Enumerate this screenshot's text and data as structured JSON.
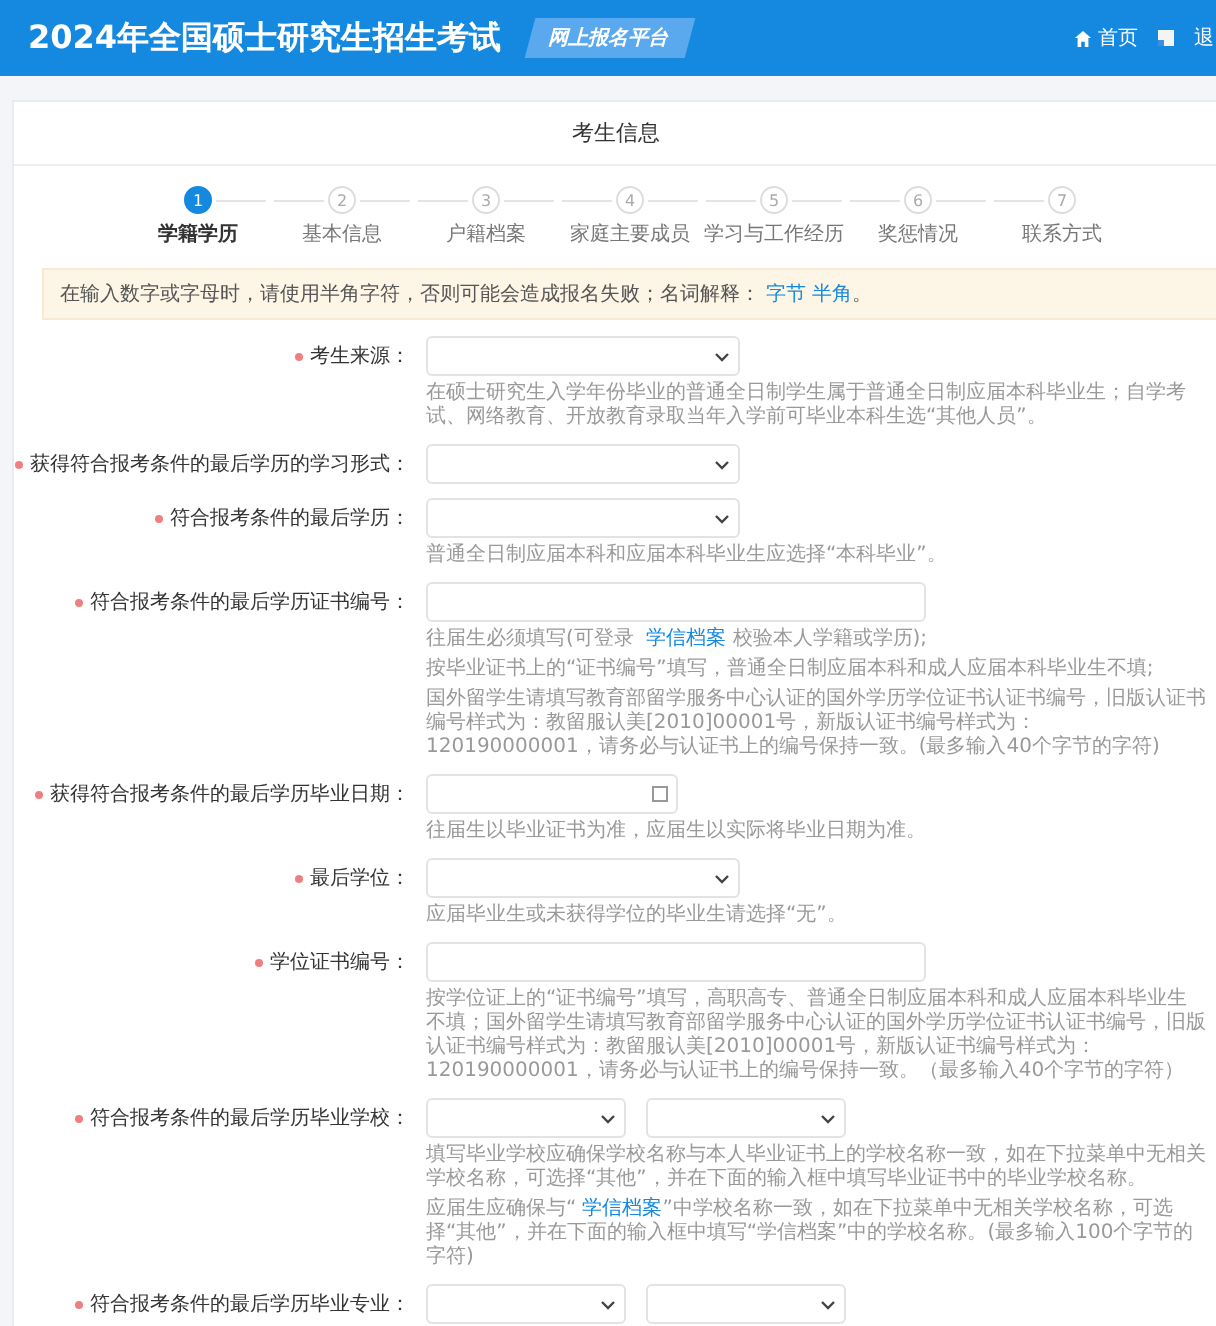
{
  "header": {
    "title": "2024年全国硕士研究生招生考试",
    "badge": "网上报名平台",
    "links": [
      {
        "kind": "home",
        "label": "首页"
      },
      {
        "kind": "exit",
        "label": "退"
      }
    ]
  },
  "card": {
    "title": "考生信息"
  },
  "steps": [
    {
      "number": "1",
      "label": "学籍学历",
      "selected": true
    },
    {
      "number": "2",
      "label": "基本信息",
      "selected": false
    },
    {
      "number": "3",
      "label": "户籍档案",
      "selected": false
    },
    {
      "number": "4",
      "label": "家庭主要成员",
      "selected": false
    },
    {
      "number": "5",
      "label": "学习与工作经历",
      "selected": false
    },
    {
      "number": "6",
      "label": "奖惩情况",
      "selected": false
    },
    {
      "number": "7",
      "label": "联系方式",
      "selected": false
    }
  ],
  "notice": [
    {
      "text": "在输入数字或字母时，请使用半角字符，否则可能会造成报名失败；名词解释："
    },
    {
      "link": "字节"
    },
    {
      "link": "半角"
    },
    {
      "text": "。"
    }
  ],
  "fields": [
    {
      "label": "考生来源：",
      "required": true,
      "kind": "select",
      "hints": [
        [
          {
            "text": "在硕士研究生入学年份毕业的普通全日制学生属于普通全日制应届本科毕业生；自学考试、网络教育、开放教育录取当年入学前可毕业本科生选“其他人员”。"
          }
        ]
      ]
    },
    {
      "label": "获得符合报考条件的最后学历的学习形式：",
      "required": true,
      "kind": "select"
    },
    {
      "label": "符合报考条件的最后学历：",
      "required": true,
      "kind": "select",
      "hints": [
        [
          {
            "text": "普通全日制应届本科和应届本科毕业生应选择“本科毕业”。"
          }
        ]
      ]
    },
    {
      "label": "符合报考条件的最后学历证书编号：",
      "required": true,
      "kind": "input",
      "hints": [
        [
          {
            "text": "往届生必须填写(可登录 "
          },
          {
            "link": "学信档案"
          },
          {
            "text": " 校验本人学籍或学历);"
          }
        ],
        [
          {
            "text": "按毕业证书上的“证书编号”填写，普通全日制应届本科和成人应届本科毕业生不填;"
          }
        ],
        [
          {
            "text": "国外留学生请填写教育部留学服务中心认证的国外学历学位证书认证书编号，旧版认证书编号样式为：教留服认美[2010]00001号，新版认证书编号样式为：120190000001，请务必与认证书上的编号保持一致。(最多输入40个字节的字符)"
          }
        ]
      ]
    },
    {
      "label": "获得符合报考条件的最后学历毕业日期：",
      "required": true,
      "kind": "date",
      "hints": [
        [
          {
            "text": "往届生以毕业证书为准，应届生以实际将毕业日期为准。"
          }
        ]
      ]
    },
    {
      "label": "最后学位：",
      "required": true,
      "kind": "select",
      "hints": [
        [
          {
            "text": "应届毕业生或未获得学位的毕业生请选择“无”。"
          }
        ]
      ]
    },
    {
      "label": "学位证书编号：",
      "required": true,
      "kind": "input",
      "hints": [
        [
          {
            "text": "按学位证上的“证书编号”填写，高职高专、普通全日制应届本科和成人应届本科毕业生不填；国外留学生请填写教育部留学服务中心认证的国外学历学位证书认证书编号，旧版认证书编号样式为：教留服认美[2010]00001号，新版认证书编号样式为：120190000001，请务必与认证书上的编号保持一致。（最多输入40个字节的字符）"
          }
        ]
      ]
    },
    {
      "label": "符合报考条件的最后学历毕业学校：",
      "required": true,
      "kind": "pair",
      "hints": [
        [
          {
            "text": "填写毕业学校应确保学校名称与本人毕业证书上的学校名称一致，如在下拉菜单中无相关学校名称，可选择“其他”，并在下面的输入框中填写毕业证书中的毕业学校名称。"
          }
        ],
        [
          {
            "text": "应届生应确保与“"
          },
          {
            "link": "学信档案"
          },
          {
            "text": "”中学校名称一致，如在下拉菜单中无相关学校名称，可选择“其他”，并在下面的输入框中填写“学信档案”中的学校名称。(最多输入100个字节的字符)"
          }
        ]
      ]
    },
    {
      "label": "符合报考条件的最后学历毕业专业：",
      "required": true,
      "kind": "pair"
    }
  ]
}
